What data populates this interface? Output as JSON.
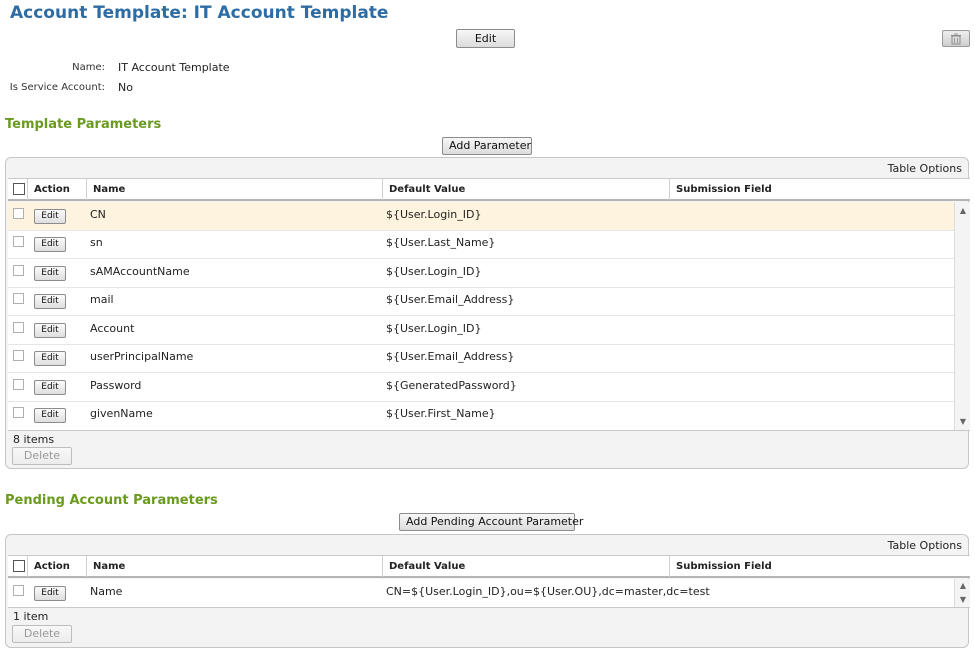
{
  "page": {
    "title": "Account Template: IT Account Template",
    "edit_label": "Edit"
  },
  "info": {
    "name_label": "Name:",
    "name_value": "IT Account Template",
    "service_label": "Is Service Account:",
    "service_value": "No"
  },
  "template_params": {
    "title": "Template Parameters",
    "add_label": "Add Parameter",
    "table_options": "Table Options",
    "columns": [
      "Action",
      "Name",
      "Default Value",
      "Submission Field"
    ],
    "rows": [
      {
        "action": "Edit",
        "name": "CN",
        "default": "${User.Login_ID}",
        "submission": ""
      },
      {
        "action": "Edit",
        "name": "sn",
        "default": "${User.Last_Name}",
        "submission": ""
      },
      {
        "action": "Edit",
        "name": "sAMAccountName",
        "default": "${User.Login_ID}",
        "submission": ""
      },
      {
        "action": "Edit",
        "name": "mail",
        "default": "${User.Email_Address}",
        "submission": ""
      },
      {
        "action": "Edit",
        "name": "Account",
        "default": "${User.Login_ID}",
        "submission": ""
      },
      {
        "action": "Edit",
        "name": "userPrincipalName",
        "default": "${User.Email_Address}",
        "submission": ""
      },
      {
        "action": "Edit",
        "name": "Password",
        "default": "${GeneratedPassword}",
        "submission": ""
      },
      {
        "action": "Edit",
        "name": "givenName",
        "default": "${User.First_Name}",
        "submission": ""
      }
    ],
    "count": "8 items",
    "delete_label": "Delete"
  },
  "pending_params": {
    "title": "Pending Account Parameters",
    "add_label": "Add Pending Account Parameter",
    "table_options": "Table Options",
    "columns": [
      "Action",
      "Name",
      "Default Value",
      "Submission Field"
    ],
    "rows": [
      {
        "action": "Edit",
        "name": "Name",
        "default": "CN=${User.Login_ID},ou=${User.OU},dc=master,dc=test",
        "submission": ""
      }
    ],
    "count": "1 item",
    "delete_label": "Delete"
  },
  "colors": {
    "title": "#2e6ca4",
    "section_title": "#6a9a1f",
    "selected_row": "#fdf3de"
  },
  "icons": {
    "delete_template": "trash-icon",
    "scroll_up": "chevron-up-icon",
    "scroll_down": "chevron-down-icon"
  }
}
